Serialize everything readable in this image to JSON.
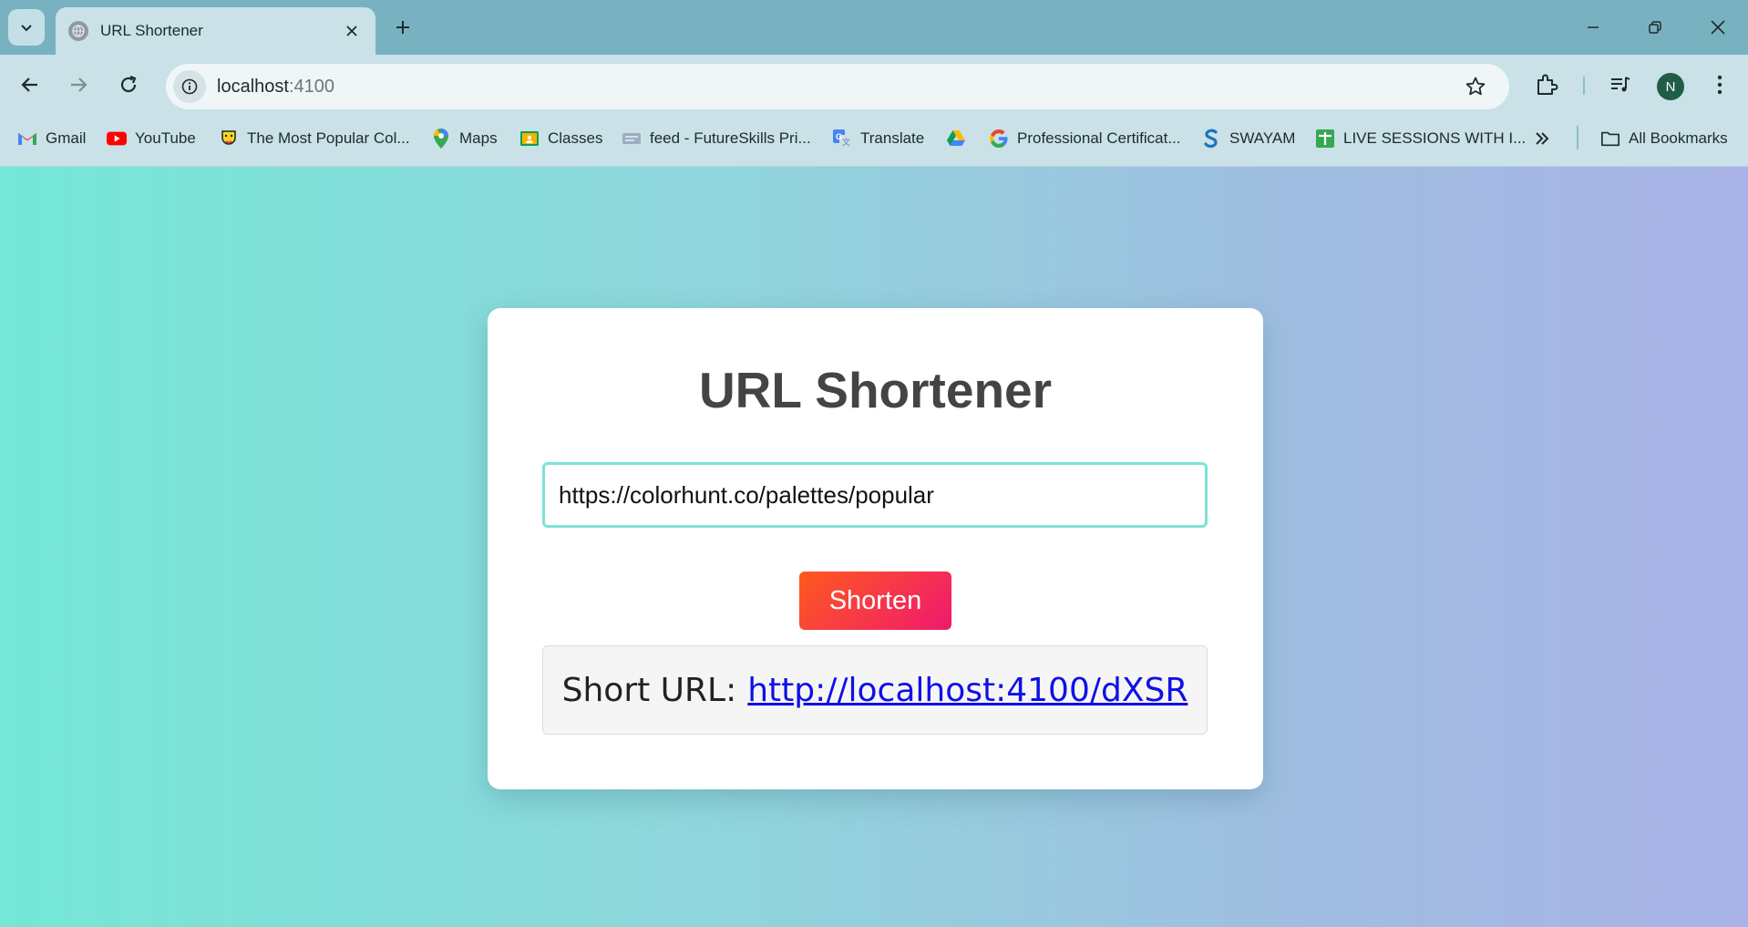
{
  "browser": {
    "tab_title": "URL Shortener",
    "url_host": "localhost",
    "url_port": ":4100",
    "profile_initial": "N",
    "accent_color": "#78b2c0"
  },
  "bookmarks": [
    {
      "label": "Gmail",
      "icon": "gmail-icon"
    },
    {
      "label": "YouTube",
      "icon": "youtube-icon"
    },
    {
      "label": "The Most Popular Col...",
      "icon": "colorhunt-icon"
    },
    {
      "label": "Maps",
      "icon": "maps-icon"
    },
    {
      "label": "Classes",
      "icon": "classroom-icon"
    },
    {
      "label": "feed - FutureSkills Pri...",
      "icon": "futureskills-icon"
    },
    {
      "label": "Translate",
      "icon": "translate-icon"
    },
    {
      "label": "",
      "icon": "drive-icon"
    },
    {
      "label": "Professional Certificat...",
      "icon": "google-icon"
    },
    {
      "label": "SWAYAM",
      "icon": "swayam-icon"
    },
    {
      "label": "LIVE SESSIONS WITH I...",
      "icon": "sheets-icon"
    }
  ],
  "all_bookmarks_label": "All Bookmarks",
  "app": {
    "title": "URL Shortener",
    "input_value": "https://colorhunt.co/palettes/popular",
    "shorten_label": "Shorten",
    "result_label": "Short URL:",
    "short_url": "http://localhost:4100/dXSR",
    "button_gradient": [
      "#fe5a1d",
      "#f0186f"
    ],
    "input_border_color": "#7de3d6"
  }
}
